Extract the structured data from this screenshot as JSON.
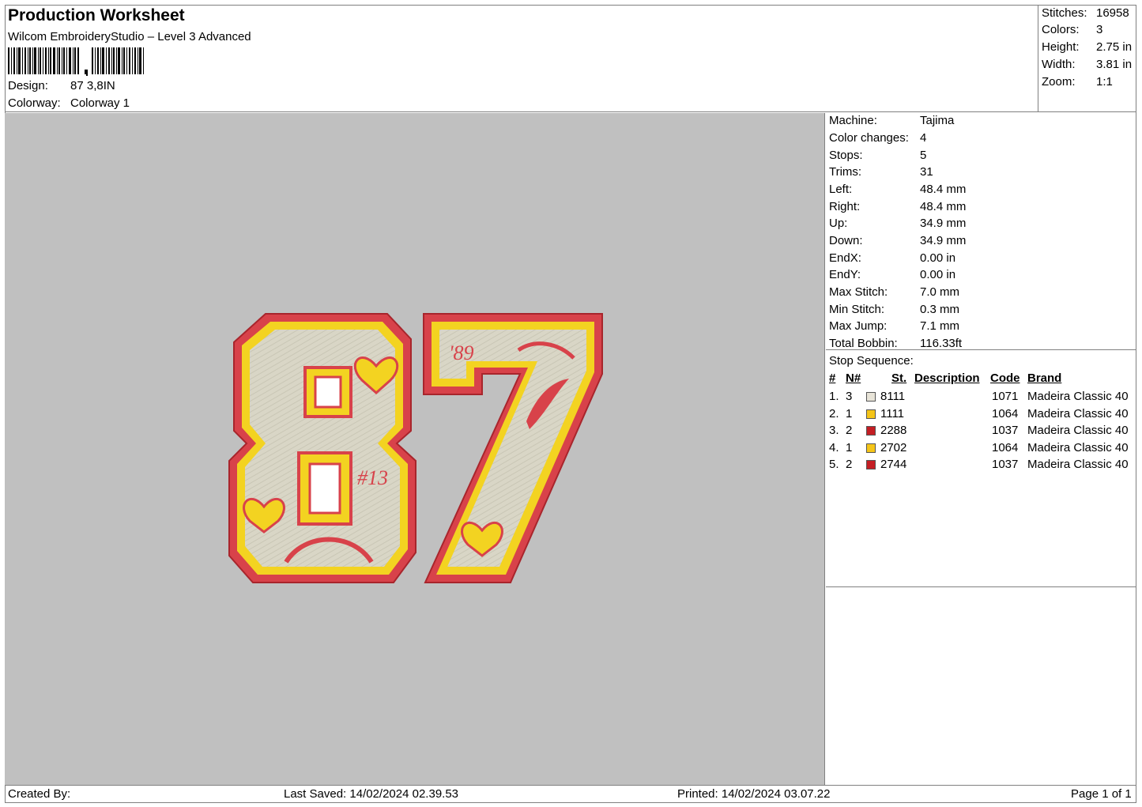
{
  "header": {
    "title": "Production Worksheet",
    "subtitle": "Wilcom EmbroideryStudio – Level 3 Advanced",
    "barcode_icon": "barcode-icon",
    "design_label": "Design:",
    "design_value": "87 3,8IN",
    "colorway_label": "Colorway:",
    "colorway_value": "Colorway 1"
  },
  "summary": [
    {
      "label": "Stitches:",
      "value": "16958"
    },
    {
      "label": "Colors:",
      "value": "3"
    },
    {
      "label": "Height:",
      "value": "2.75 in"
    },
    {
      "label": "Width:",
      "value": "3.81 in"
    },
    {
      "label": "Zoom:",
      "value": "1:1"
    }
  ],
  "design_preview": {
    "text_number": "87",
    "text_tag_left": "#13",
    "text_tag_right": "'89",
    "colors": {
      "fill": "#d9d6c6",
      "yellow": "#f3d321",
      "red": "#d8424a",
      "background": "#c0c0c0"
    }
  },
  "machine": [
    {
      "label": "Machine:",
      "value": "Tajima"
    },
    {
      "label": "Color changes:",
      "value": "4"
    },
    {
      "label": "Stops:",
      "value": "5"
    },
    {
      "label": "Trims:",
      "value": "31"
    },
    {
      "label": "Left:",
      "value": "48.4 mm"
    },
    {
      "label": "Right:",
      "value": "48.4 mm"
    },
    {
      "label": "Up:",
      "value": "34.9 mm"
    },
    {
      "label": "Down:",
      "value": "34.9 mm"
    },
    {
      "label": "EndX:",
      "value": "0.00 in"
    },
    {
      "label": "EndY:",
      "value": "0.00 in"
    },
    {
      "label": "Max Stitch:",
      "value": "7.0 mm"
    },
    {
      "label": "Min Stitch:",
      "value": "0.3 mm"
    },
    {
      "label": "Max Jump:",
      "value": "7.1 mm"
    },
    {
      "label": "Total Bobbin:",
      "value": "116.33ft"
    }
  ],
  "stop_sequence": {
    "title": "Stop Sequence:",
    "headers": {
      "num": "#",
      "n": "N#",
      "st": "St.",
      "description": "Description",
      "code": "Code",
      "brand": "Brand"
    },
    "rows": [
      {
        "num": "1.",
        "n": "3",
        "color": "#e8e4d8",
        "st": "8111",
        "code": "1071",
        "brand": "Madeira Classic 40"
      },
      {
        "num": "2.",
        "n": "1",
        "color": "#f5c518",
        "st": "1111",
        "code": "1064",
        "brand": "Madeira Classic 40"
      },
      {
        "num": "3.",
        "n": "2",
        "color": "#c41e24",
        "st": "2288",
        "code": "1037",
        "brand": "Madeira Classic 40"
      },
      {
        "num": "4.",
        "n": "1",
        "color": "#f5c518",
        "st": "2702",
        "code": "1064",
        "brand": "Madeira Classic 40"
      },
      {
        "num": "5.",
        "n": "2",
        "color": "#c41e24",
        "st": "2744",
        "code": "1037",
        "brand": "Madeira Classic 40"
      }
    ]
  },
  "footer": {
    "created_by": "Created By:",
    "last_saved": "Last Saved: 14/02/2024 02.39.53",
    "printed": "Printed: 14/02/2024 03.07.22",
    "page": "Page 1 of 1"
  }
}
